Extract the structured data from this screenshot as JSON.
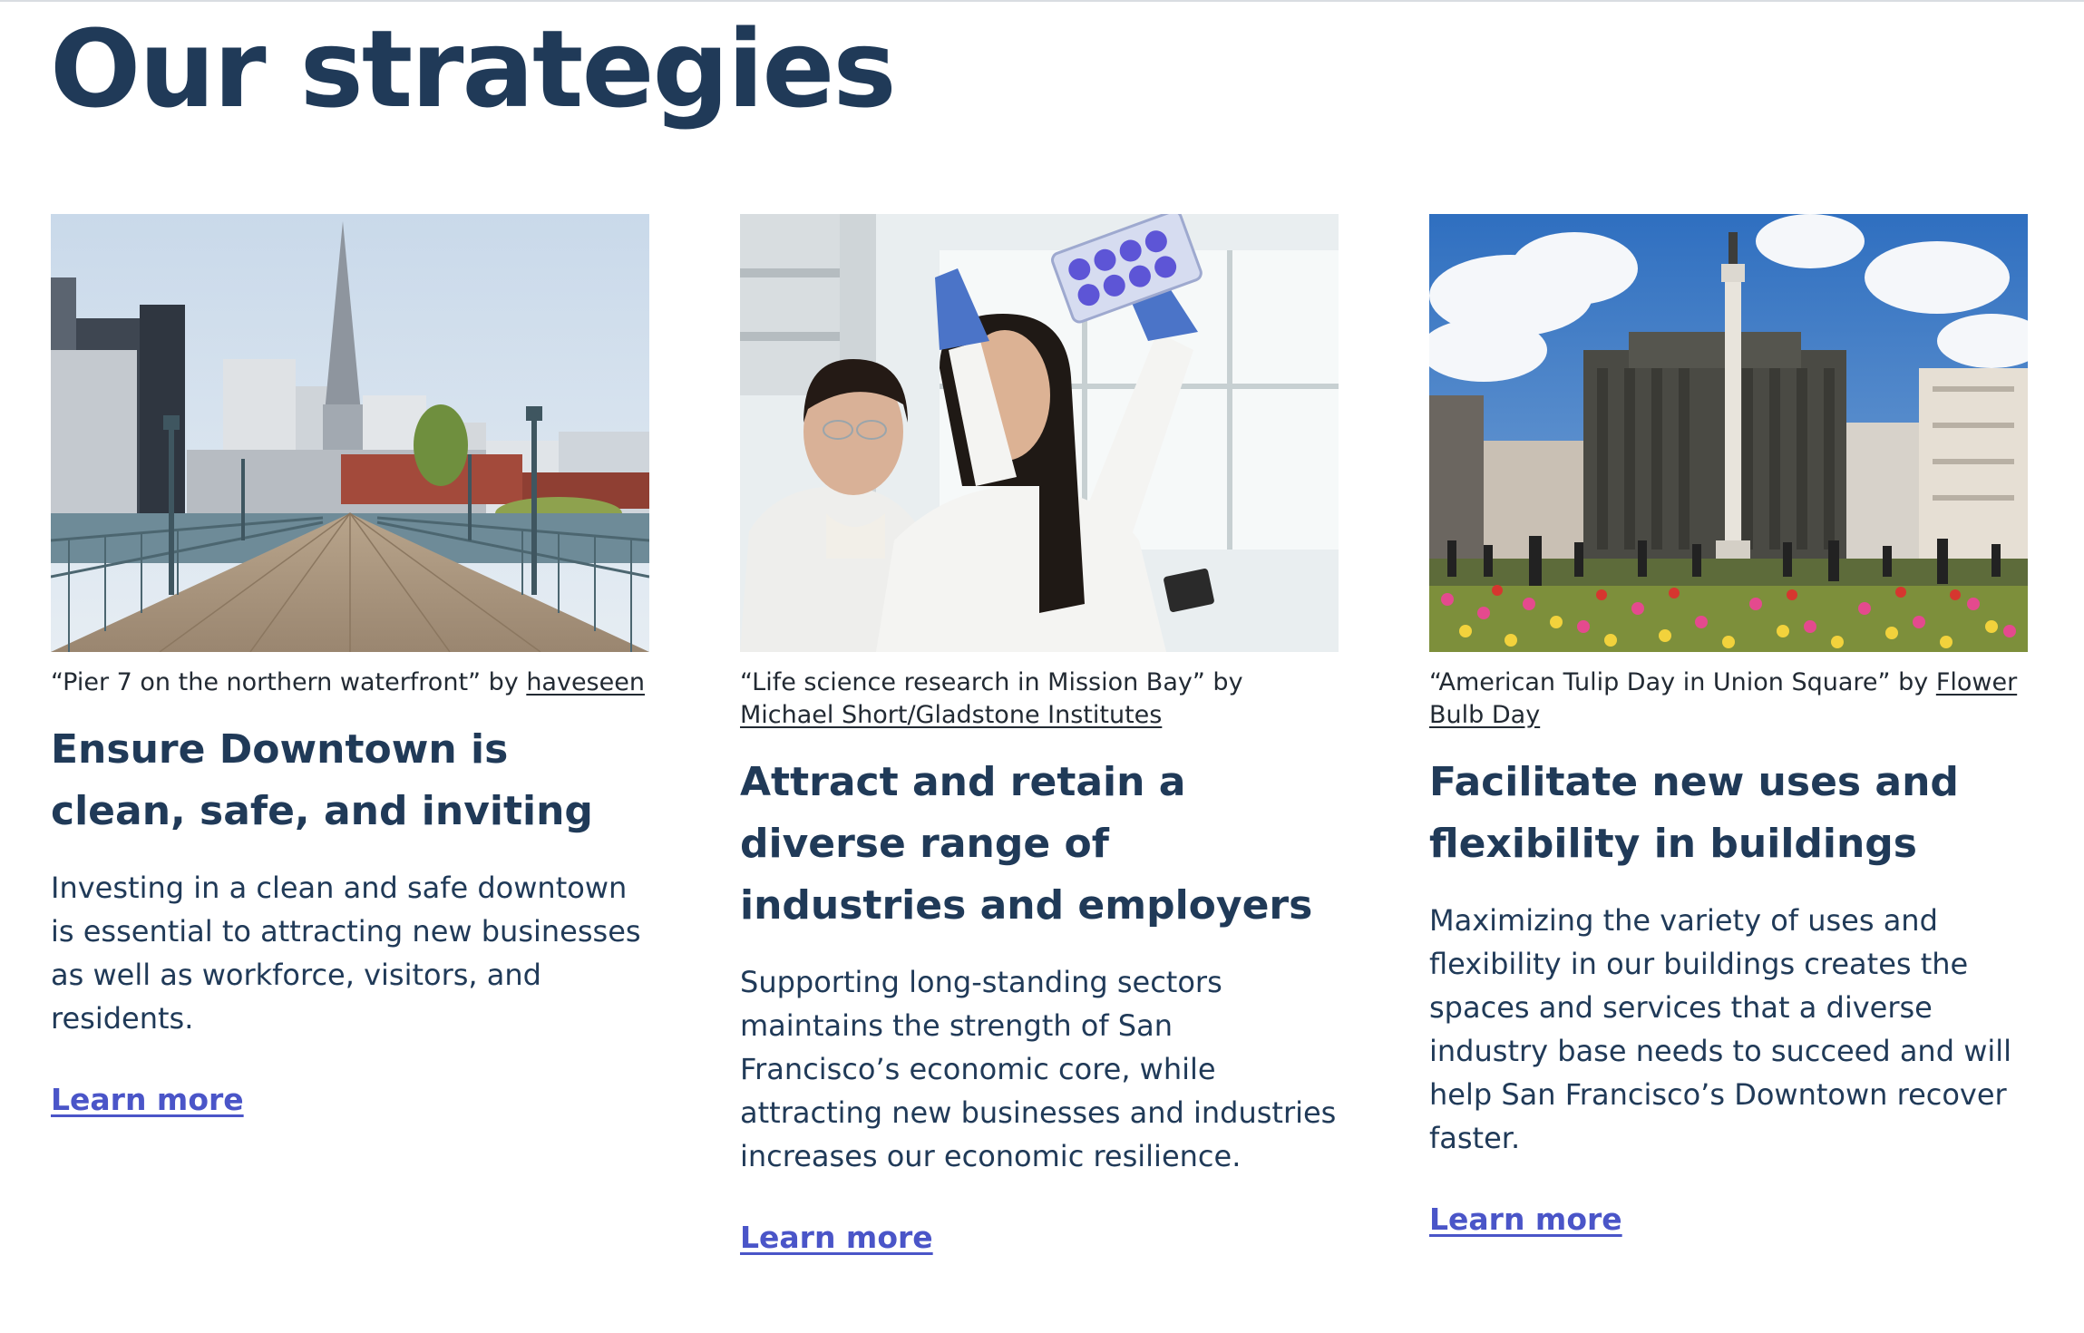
{
  "page": {
    "title": "Our strategies"
  },
  "strategies": [
    {
      "photo_icon": "waterfront-pier-photo",
      "caption_prefix": "“Pier 7 on the northern waterfront” by ",
      "credit": "haveseen",
      "title": "Ensure Downtown is clean, safe, and inviting",
      "body": "Investing in a clean and safe downtown is essential to attracting new businesses as well as workforce, visitors, and residents.",
      "link": "Learn more"
    },
    {
      "photo_icon": "lab-researchers-photo",
      "caption_prefix": "“Life science research in Mission Bay” by ",
      "credit": "Michael Short/Gladstone Institutes",
      "title": "Attract and retain a diverse range of industries and employers",
      "body": "Supporting long-standing sectors maintains the strength of San Francisco’s economic core, while attracting new businesses and industries increases our economic resilience.",
      "link": "Learn more"
    },
    {
      "photo_icon": "union-square-tulips-photo",
      "caption_prefix": "“American Tulip Day in Union Square” by ",
      "credit": "Flower Bulb Day",
      "title": "Facilitate new uses and flexibility in buildings",
      "body": "Maximizing the variety of uses and flexibility in our buildings creates the spaces and services that a diverse industry base needs to succeed and will help San Francisco’s Downtown recover faster.",
      "link": "Learn more"
    }
  ],
  "colors": {
    "heading": "#203a58",
    "link": "#4a55c8",
    "caption": "#222a33"
  }
}
